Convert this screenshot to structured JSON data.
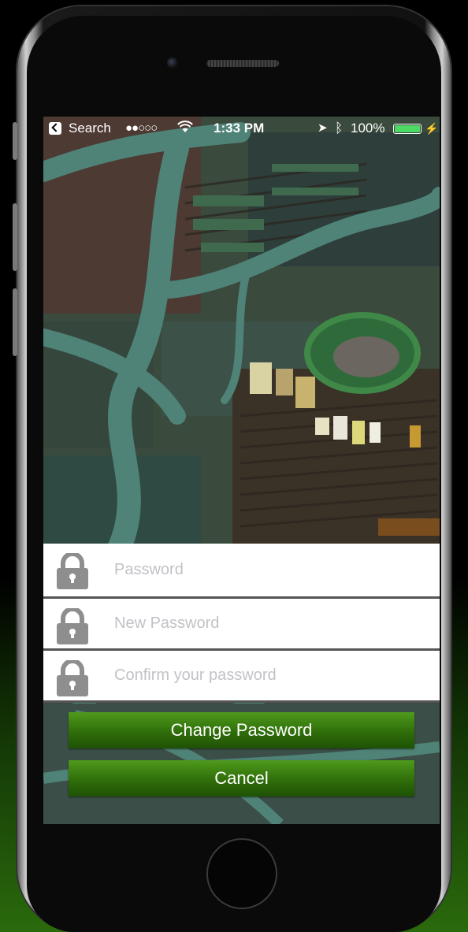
{
  "status_bar": {
    "back_label": "Search",
    "signal": "●●○○○",
    "wifi": "wifi-icon",
    "time": "1:33 PM",
    "location": "location-arrow-icon",
    "bluetooth": "bluetooth-icon",
    "battery_percent": "100%",
    "battery_level": 1.0,
    "battery_color": "#4cd964"
  },
  "form": {
    "password": {
      "placeholder": "Password",
      "icon": "lock-icon"
    },
    "new_password": {
      "placeholder": "New Password",
      "icon": "lock-icon"
    },
    "confirm_password": {
      "placeholder": "Confirm your password",
      "icon": "lock-icon"
    }
  },
  "buttons": {
    "change_password": "Change Password",
    "cancel": "Cancel"
  },
  "colors": {
    "button_green": "#2f6e0a",
    "field_bg": "#ffffff",
    "lock_gray": "#8e8e8e"
  }
}
